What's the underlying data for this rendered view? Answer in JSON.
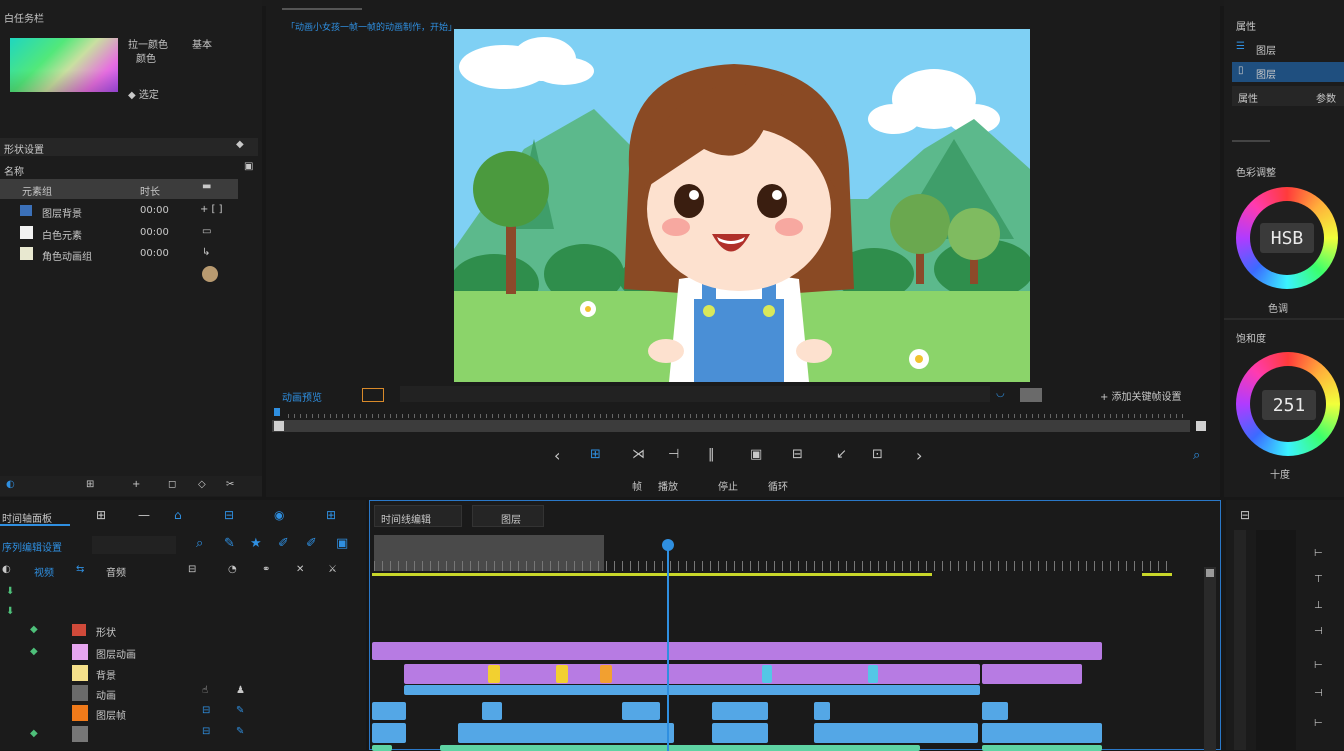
{
  "left_panel": {
    "header_title": "白任务栏",
    "color_text_1": "拉一颜色",
    "color_text_2": "基本",
    "color_text_3": "颜色",
    "color_text_4": "◆ 选定",
    "clips_header": "形状设置",
    "clips_sub": "名称",
    "list_header_name": "元素组",
    "list_header_time": "时长",
    "items": [
      {
        "name": "图层背景",
        "time": "00:00"
      },
      {
        "name": "白色元素",
        "time": "00:00"
      },
      {
        "name": "角色动画组",
        "time": "00:00"
      }
    ],
    "bottom_tools": [
      "◐",
      "⊞",
      "+",
      "◻",
      "◇",
      "✂"
    ]
  },
  "preview": {
    "top_caption": "「动画小女孩一帧一帧的动画制作，开始」",
    "label_left": "动画预览",
    "label_right": "+ 添加关键帧设置",
    "transport_caption": [
      "帧",
      "播放",
      "停止",
      "循环"
    ]
  },
  "right_panel": {
    "title": "属性",
    "option_1": "图层",
    "option_2": "图层",
    "option_3": "属性",
    "option_3_value": "参数",
    "dial1_label": "色彩调整",
    "dial1_value": "HSB",
    "dial1_caption": "色调",
    "dial2_label": "饱和度",
    "dial2_value": "251",
    "dial2_caption": "十度"
  },
  "timeline": {
    "panel_title": "时间轴面板",
    "sub_title": "序列编辑设置",
    "tab_1": "时间线编辑",
    "tab_2": "图层",
    "col_1": "视频",
    "col_2": "音频",
    "track_labels": [
      "形状",
      "图层动画",
      "背景",
      "动画",
      "图层帧"
    ]
  },
  "colors": {
    "accent": "#2f8fe0",
    "purple": "#b77be3",
    "blue": "#54a7e6",
    "green": "#5ed3a3",
    "yellow": "#c9d72a"
  }
}
